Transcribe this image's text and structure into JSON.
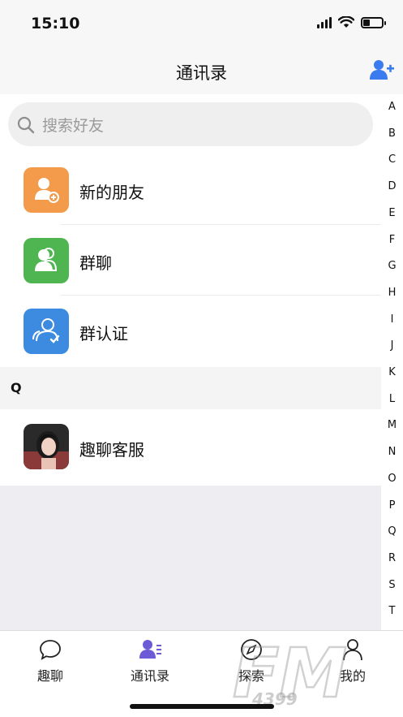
{
  "status_bar": {
    "time": "15:10",
    "battery_level": 0.35
  },
  "nav": {
    "title": "通讯录",
    "add_icon": "add-contact-icon"
  },
  "search": {
    "placeholder": "搜索好友"
  },
  "functions": [
    {
      "label": "新的朋友",
      "icon": "new-friend-icon",
      "color": "#F39A4B"
    },
    {
      "label": "群聊",
      "icon": "group-chat-icon",
      "color": "#4FB551"
    },
    {
      "label": "群认证",
      "icon": "group-verify-icon",
      "color": "#3D8BE0"
    }
  ],
  "section": {
    "header": "Q"
  },
  "contacts": [
    {
      "name": "趣聊客服",
      "avatar": "photo-avatar"
    }
  ],
  "index_letters": [
    "A",
    "B",
    "C",
    "D",
    "E",
    "F",
    "G",
    "H",
    "I",
    "J",
    "K",
    "L",
    "M",
    "N",
    "O",
    "P",
    "Q",
    "R",
    "S",
    "T"
  ],
  "tabs": [
    {
      "label": "趣聊",
      "icon": "chat-bubble-icon",
      "active": false
    },
    {
      "label": "通讯录",
      "icon": "contacts-icon",
      "active": true
    },
    {
      "label": "探索",
      "icon": "compass-icon",
      "active": false
    },
    {
      "label": "我的",
      "icon": "profile-icon",
      "active": false
    }
  ],
  "watermark": {
    "text": "FM",
    "subtext": "4399"
  },
  "colors": {
    "accent": "#3A7BF0",
    "tab_active": "#6B5BD6"
  }
}
